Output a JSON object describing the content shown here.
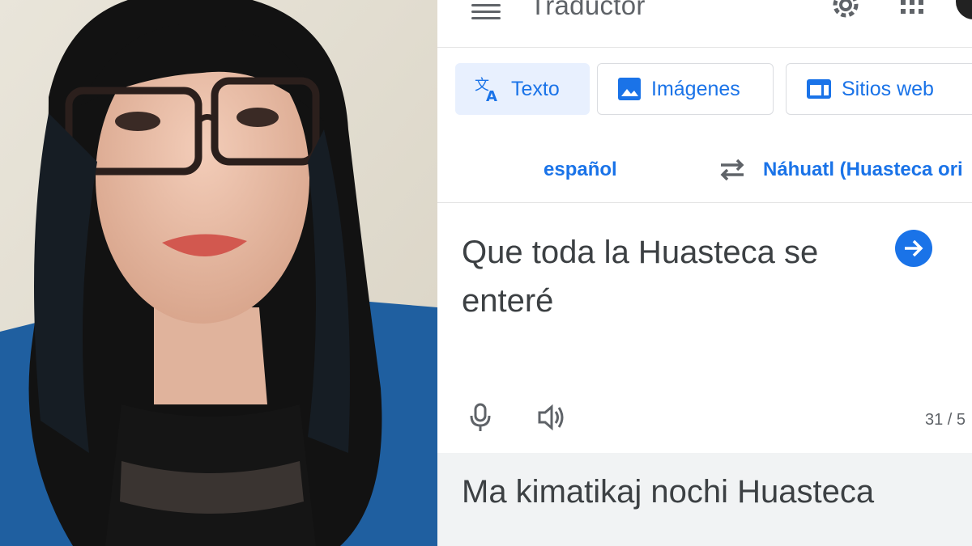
{
  "photo": {
    "description_icon": "selfie-photo"
  },
  "app": {
    "title": "Traductor",
    "icons": {
      "menu": "hamburger-menu-icon",
      "settings": "gear-icon",
      "apps": "apps-grid-icon"
    }
  },
  "tabs": [
    {
      "label": "Texto",
      "icon": "translate-icon",
      "active": true
    },
    {
      "label": "Imágenes",
      "icon": "image-icon",
      "active": false
    },
    {
      "label": "Sitios web",
      "icon": "web-icon",
      "active": false
    }
  ],
  "languages": {
    "source": "español",
    "target": "Náhuatl (Huasteca ori"
  },
  "input": {
    "text_line1": "Que toda la Huasteca se",
    "text_line2": "enteré",
    "char_count": "31 / 5"
  },
  "output": {
    "text": "Ma kimatikaj nochi Huasteca"
  },
  "colors": {
    "accent": "#1a73e8",
    "active_tab_bg": "#e8f0fe",
    "output_bg": "#f1f3f4"
  }
}
